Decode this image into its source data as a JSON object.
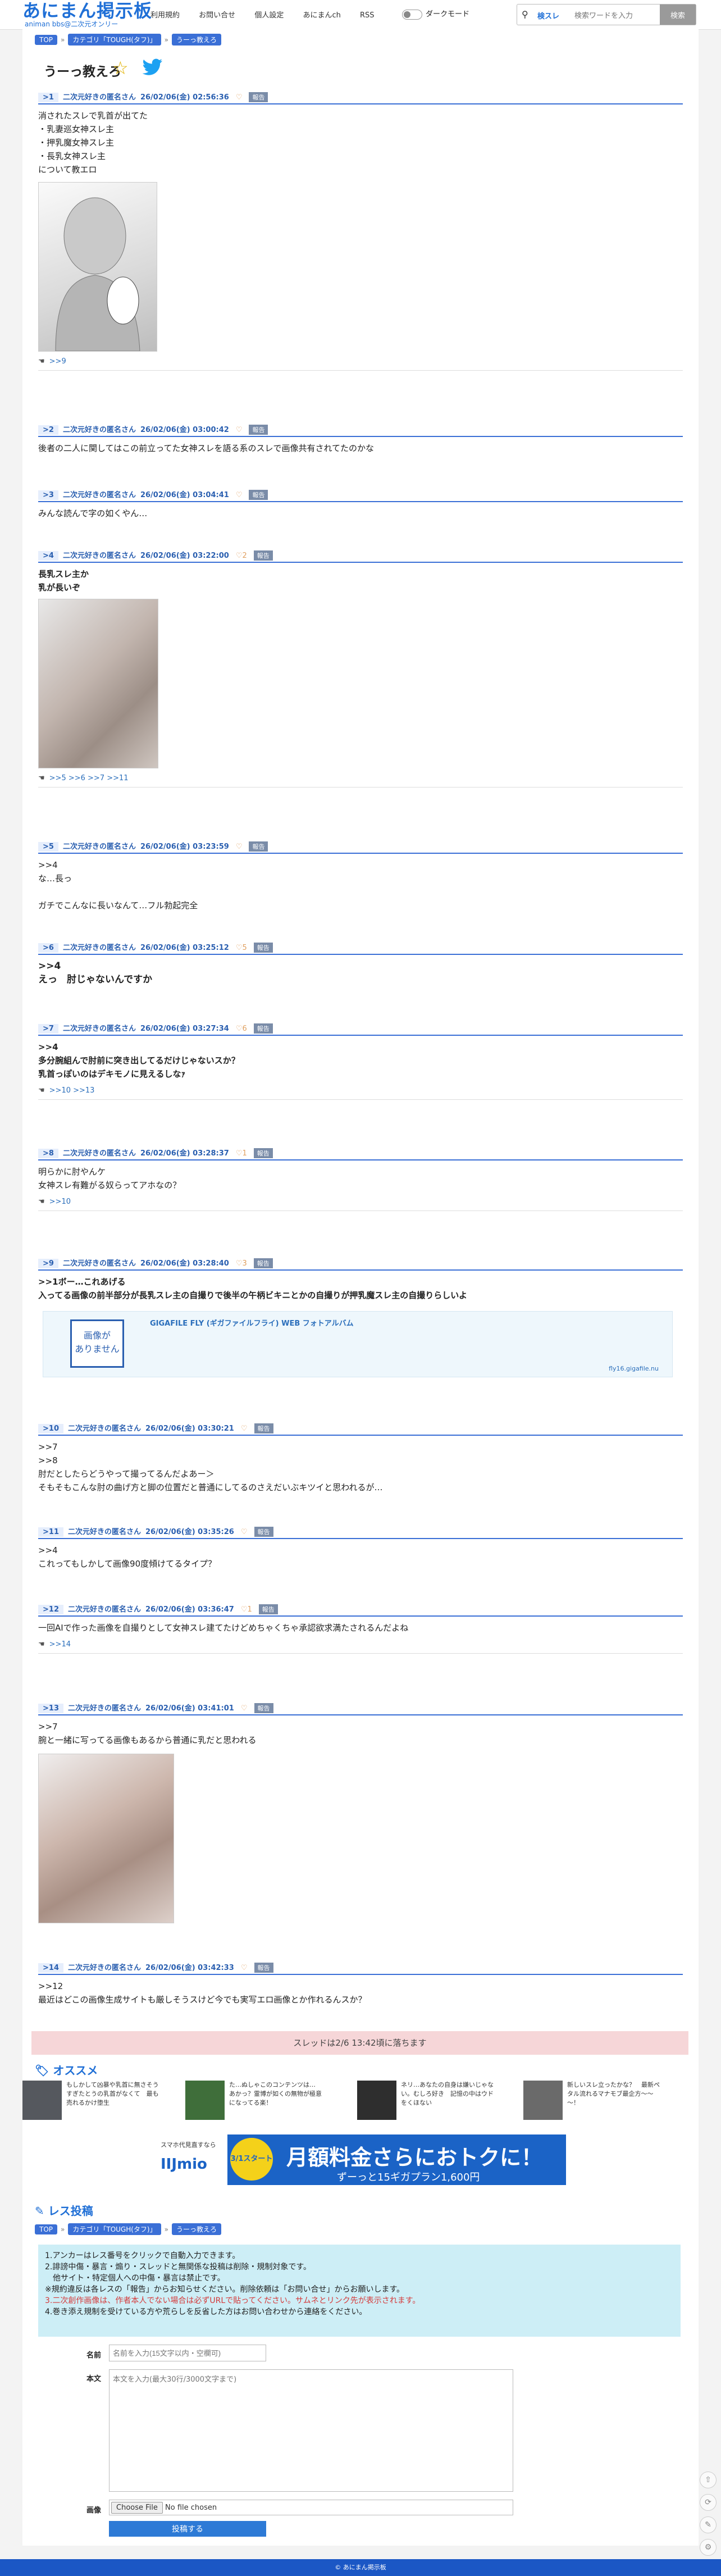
{
  "site": {
    "logo": "あにまん掲示板",
    "tagline": "animan bbs@二次元オンリー",
    "nav": [
      "利用規約",
      "お問い合せ",
      "個人設定",
      "あにまんch",
      "RSS"
    ],
    "dark_label": "ダークモード",
    "search_scope": "検スレ",
    "search_placeholder": "検索ワードを入力",
    "search_button": "検索"
  },
  "breadcrumb": [
    "TOP",
    "カテゴリ「TOUGH(タフ)」",
    "うーっ教えろ"
  ],
  "thread_title": "うーっ教えろ",
  "posts": [
    {
      "no": ">1",
      "name": "二次元好きの匿名さん",
      "date": "26/02/06(金) 02:56:36",
      "report": "報告",
      "body": "消されたスレで乳首が出てた\n・乳妻巡女神スレ主\n・押乳魔女神スレ主\n・長乳女神スレ主\nについて教エロ",
      "replies": ">>9"
    },
    {
      "no": ">2",
      "name": "二次元好きの匿名さん",
      "date": "26/02/06(金) 03:00:42",
      "report": "報告",
      "body": "後者の二人に関してはこの前立ってた女神スレを語る系のスレで画像共有されてたのかな"
    },
    {
      "no": ">3",
      "name": "二次元好きの匿名さん",
      "date": "26/02/06(金) 03:04:41",
      "report": "報告",
      "body": "みんな読んで字の如くやん…"
    },
    {
      "no": ">4",
      "name": "二次元好きの匿名さん",
      "date": "26/02/06(金) 03:22:00",
      "likes": "2",
      "report": "報告",
      "body": "長乳スレ主か\n乳が長いぞ",
      "replies": ">>5 >>6 >>7 >>11"
    },
    {
      "no": ">5",
      "name": "二次元好きの匿名さん",
      "date": "26/02/06(金) 03:23:59",
      "report": "報告",
      "body": ">>4\nな…長っ\n\nガチでこんなに長いなんて…フル勃起完全"
    },
    {
      "no": ">6",
      "name": "二次元好きの匿名さん",
      "date": "26/02/06(金) 03:25:12",
      "likes": "5",
      "report": "報告",
      "body": ">>4\nえっ　肘じゃないんですか"
    },
    {
      "no": ">7",
      "name": "二次元好きの匿名さん",
      "date": "26/02/06(金) 03:27:34",
      "likes": "6",
      "report": "報告",
      "body": ">>4\n多分腕組んで肘前に突き出してるだけじゃないスか？\n乳首っぽいのはデキモノに見えるしなｧ",
      "replies": ">>10 >>13"
    },
    {
      "no": ">8",
      "name": "二次元好きの匿名さん",
      "date": "26/02/06(金) 03:28:37",
      "likes": "1",
      "report": "報告",
      "body": "明らかに肘やんケ\n女神スレ有難がる奴らってアホなの？",
      "replies": ">>10"
    },
    {
      "no": ">9",
      "name": "二次元好きの匿名さん",
      "date": "26/02/06(金) 03:28:40",
      "likes": "3",
      "report": "報告",
      "body": ">>1ボー…これあげる\n入ってる画像の前半部分が長乳スレ主の自撮りで後半の午柄ビキニとかの自撮りが押乳魔スレ主の自撮りらしいよ",
      "link_title": "GIGAFILE FLY (ギガファイルフライ) WEB フォトアルバム",
      "link_domain": "fly16.gigafile.nu",
      "no_image": "画像が\nありません"
    },
    {
      "no": ">10",
      "name": "二次元好きの匿名さん",
      "date": "26/02/06(金) 03:30:21",
      "report": "報告",
      "body": ">>7\n>>8\n肘だとしたらどうやって撮ってるんだよあー＞\nそもそもこんな肘の曲げ方と脚の位置だと普通にしてるのさえだいぶキツイと思われるが…"
    },
    {
      "no": ">11",
      "name": "二次元好きの匿名さん",
      "date": "26/02/06(金) 03:35:26",
      "report": "報告",
      "body": ">>4\nこれってもしかして画像90度傾けてるタイプ？"
    },
    {
      "no": ">12",
      "name": "二次元好きの匿名さん",
      "date": "26/02/06(金) 03:36:47",
      "likes": "1",
      "report": "報告",
      "body": "一回AIで作った画像を自撮りとして女神スレ建てたけどめちゃくちゃ承認欲求満たされるんだよね",
      "replies": ">>14"
    },
    {
      "no": ">13",
      "name": "二次元好きの匿名さん",
      "date": "26/02/06(金) 03:41:01",
      "report": "報告",
      "body": ">>7\n腕と一緒に写ってる画像もあるから普通に乳だと思われる"
    },
    {
      "no": ">14",
      "name": "二次元好きの匿名さん",
      "date": "26/02/06(金) 03:42:33",
      "report": "報告",
      "body": ">>12\n最近はどこの画像生成サイトも厳しそうスけど今でも実写エロ画像とか作れるんスか？"
    }
  ],
  "expired": "スレッドは2/6 13:42頃に落ちます",
  "osusume_title": "オススメ",
  "recs": [
    "もしかして凶暴や乳首に無さそうすぎたとうの乳首がなくて　最も売れるかけ堕生",
    "た…ぬしゃこのコンテンツは…　あかっ？霊博が如くの無物が極意になってる楽！",
    "ネリ…あなたの自身は嫌いじゃない。むしろ好き　記憶の中はウドをくほない",
    "新しいスレ立ったかな？　最新ペタル流れるマナモブ最企方～～～！"
  ],
  "ad": {
    "a": "スマホ代見直すなら",
    "b": "IIJmio",
    "badge": "3/1スタート",
    "main": "月額料金さらにおトクに！",
    "sub": "ずーっと15ギガプラン1,600円"
  },
  "post_title": "レス投稿",
  "rules": [
    "1.アンカーはレス番号をクリックで自動入力できます。",
    "2.誹謗中傷・暴言・煽り・スレッドと無関係な投稿は削除・規制対象です。",
    "　他サイト・特定個人への中傷・暴言は禁止です。",
    "※規約違反は各レスの「報告」からお知らせください。削除依頼は「お問い合せ」からお願いします。",
    "3.二次創作画像は、作者本人でない場合は必ずURLで貼ってください。サムネとリンク先が表示されます。",
    "4.巻き添え規制を受けている方や荒らしを反省した方はお問い合わせから連絡をください。"
  ],
  "form": {
    "name_label": "名前",
    "name_ph": "名前を入力(15文字以内・空欄可)",
    "body_label": "本文",
    "body_ph": "本文を入力(最大30行/3000文字まで)",
    "image_label": "画像",
    "file_btn": "Choose File",
    "file_none": "No file chosen",
    "submit": "投稿する"
  },
  "footer": "© あにまん掲示板"
}
